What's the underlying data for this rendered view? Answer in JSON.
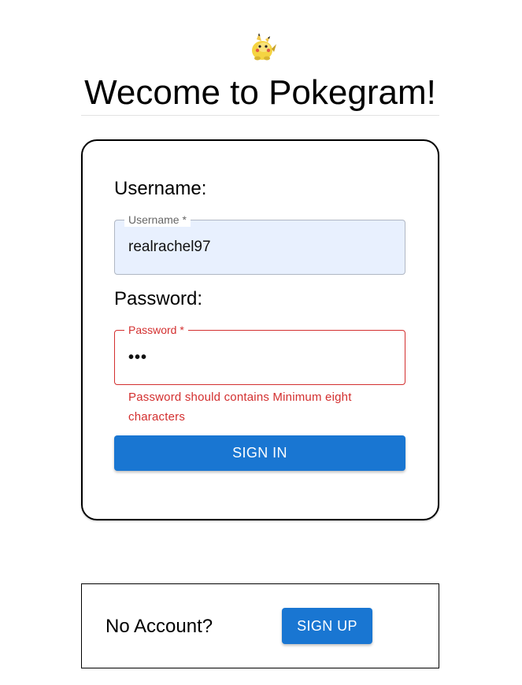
{
  "header": {
    "logo_icon": "pikachu-icon",
    "title": "Wecome to Pokegram!"
  },
  "signin": {
    "username_heading": "Username:",
    "username_label": "Username *",
    "username_value": "realrachel97",
    "password_heading": "Password:",
    "password_label": "Password *",
    "password_value": "•••",
    "password_error": "Password should contains Minimum eight characters",
    "submit_label": "SIGN IN"
  },
  "signup": {
    "prompt": "No Account?",
    "button_label": "SIGN UP"
  },
  "colors": {
    "primary": "#1976d2",
    "error": "#d32f2f",
    "autofill_bg": "#e8f0fe"
  }
}
